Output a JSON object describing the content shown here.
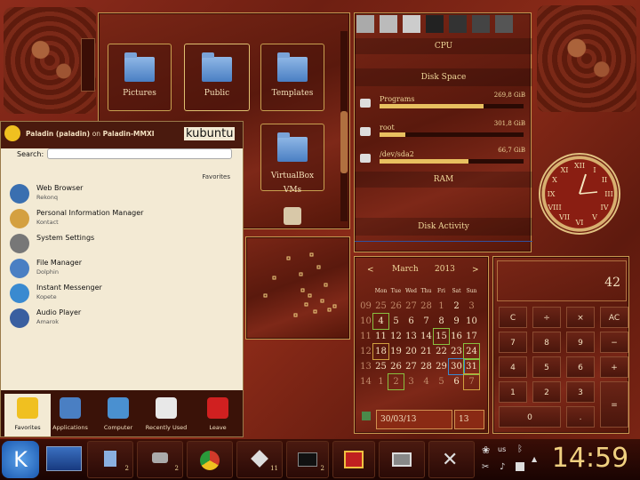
{
  "folders": [
    "Pictures",
    "Public",
    "Templates",
    "VirtualBox VMs"
  ],
  "sysmon": {
    "cpu": "CPU",
    "disk_space": "Disk Space",
    "ram": "RAM",
    "disk_activity": "Disk Activity",
    "disks": [
      {
        "name": "Programs",
        "size": "269,8 GiB",
        "fill": 0.72
      },
      {
        "name": "root",
        "size": "301,8 GiB",
        "fill": 0.18
      },
      {
        "name": "/dev/sda2",
        "size": "66,7 GiB",
        "fill": 0.62
      }
    ]
  },
  "menu": {
    "user": "Paladin (paladin)",
    "on": "on",
    "host": "Paladin-MMXI",
    "brand": "kubuntu",
    "search_label": "Search:",
    "section": "Favorites",
    "items": [
      {
        "title": "Web Browser",
        "sub": "Rekonq",
        "icon": "globe-icon",
        "color": "#3a6fb0"
      },
      {
        "title": "Personal Information Manager",
        "sub": "Kontact",
        "icon": "kontact-icon",
        "color": "#d4a040"
      },
      {
        "title": "System Settings",
        "sub": "",
        "icon": "settings-icon",
        "color": "#777"
      },
      {
        "title": "File Manager",
        "sub": "Dolphin",
        "icon": "folder-icon",
        "color": "#4a7fc3"
      },
      {
        "title": "Instant Messenger",
        "sub": "Kopete",
        "icon": "chat-icon",
        "color": "#3a8ad0"
      },
      {
        "title": "Audio Player",
        "sub": "Amarok",
        "icon": "audio-icon",
        "color": "#3a5fa0"
      }
    ],
    "tabs": [
      "Favorites",
      "Applications",
      "Computer",
      "Recently Used",
      "Leave"
    ]
  },
  "calendar": {
    "month": "March",
    "year": "2013",
    "prev": "<",
    "next": ">",
    "days": [
      "Mon",
      "Tue",
      "Wed",
      "Thu",
      "Fri",
      "Sat",
      "Sun"
    ],
    "weeks": [
      [
        "09",
        "25",
        "26",
        "27",
        "28",
        "1",
        "2",
        "3"
      ],
      [
        "10",
        "4",
        "5",
        "6",
        "7",
        "8",
        "9",
        "10"
      ],
      [
        "11",
        "11",
        "12",
        "13",
        "14",
        "15",
        "16",
        "17"
      ],
      [
        "12",
        "18",
        "19",
        "20",
        "21",
        "22",
        "23",
        "24"
      ],
      [
        "13",
        "25",
        "26",
        "27",
        "28",
        "29",
        "30",
        "31"
      ],
      [
        "14",
        "1",
        "2",
        "3",
        "4",
        "5",
        "6",
        "7"
      ]
    ],
    "date_field": "30/03/13",
    "week_field": "13"
  },
  "calculator": {
    "display": "42",
    "keys": [
      "C",
      "÷",
      "×",
      "AC",
      "7",
      "8",
      "9",
      "−",
      "4",
      "5",
      "6",
      "+",
      "1",
      "2",
      "3",
      "=",
      "0",
      "."
    ]
  },
  "tray": {
    "lang": "us",
    "clock": "14:59"
  },
  "task_badges": [
    "2",
    "2",
    "11",
    "2"
  ]
}
